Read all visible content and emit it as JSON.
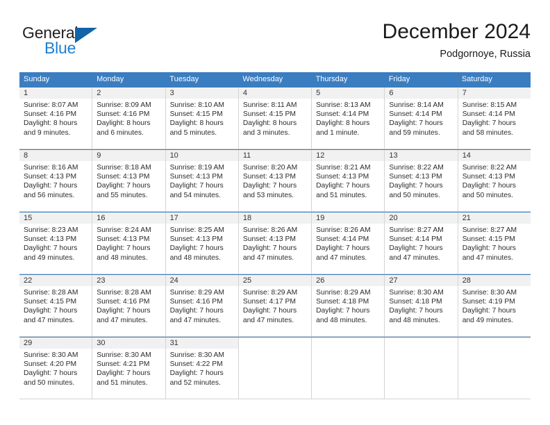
{
  "brand": {
    "name_part1": "General",
    "name_part2": "Blue"
  },
  "header": {
    "title": "December 2024",
    "subtitle": "Podgornoye, Russia"
  },
  "colors": {
    "header_blue": "#3a7dc0",
    "brand_blue": "#1b7fd4",
    "triangle_blue": "#1164a8",
    "daynum_bg": "#f1f1f1",
    "cell_border": "#d4d4d4"
  },
  "weekdays": [
    "Sunday",
    "Monday",
    "Tuesday",
    "Wednesday",
    "Thursday",
    "Friday",
    "Saturday"
  ],
  "weeks": [
    [
      {
        "day": "1",
        "sunrise": "Sunrise: 8:07 AM",
        "sunset": "Sunset: 4:16 PM",
        "daylight1": "Daylight: 8 hours",
        "daylight2": "and 9 minutes."
      },
      {
        "day": "2",
        "sunrise": "Sunrise: 8:09 AM",
        "sunset": "Sunset: 4:16 PM",
        "daylight1": "Daylight: 8 hours",
        "daylight2": "and 6 minutes."
      },
      {
        "day": "3",
        "sunrise": "Sunrise: 8:10 AM",
        "sunset": "Sunset: 4:15 PM",
        "daylight1": "Daylight: 8 hours",
        "daylight2": "and 5 minutes."
      },
      {
        "day": "4",
        "sunrise": "Sunrise: 8:11 AM",
        "sunset": "Sunset: 4:15 PM",
        "daylight1": "Daylight: 8 hours",
        "daylight2": "and 3 minutes."
      },
      {
        "day": "5",
        "sunrise": "Sunrise: 8:13 AM",
        "sunset": "Sunset: 4:14 PM",
        "daylight1": "Daylight: 8 hours",
        "daylight2": "and 1 minute."
      },
      {
        "day": "6",
        "sunrise": "Sunrise: 8:14 AM",
        "sunset": "Sunset: 4:14 PM",
        "daylight1": "Daylight: 7 hours",
        "daylight2": "and 59 minutes."
      },
      {
        "day": "7",
        "sunrise": "Sunrise: 8:15 AM",
        "sunset": "Sunset: 4:14 PM",
        "daylight1": "Daylight: 7 hours",
        "daylight2": "and 58 minutes."
      }
    ],
    [
      {
        "day": "8",
        "sunrise": "Sunrise: 8:16 AM",
        "sunset": "Sunset: 4:13 PM",
        "daylight1": "Daylight: 7 hours",
        "daylight2": "and 56 minutes."
      },
      {
        "day": "9",
        "sunrise": "Sunrise: 8:18 AM",
        "sunset": "Sunset: 4:13 PM",
        "daylight1": "Daylight: 7 hours",
        "daylight2": "and 55 minutes."
      },
      {
        "day": "10",
        "sunrise": "Sunrise: 8:19 AM",
        "sunset": "Sunset: 4:13 PM",
        "daylight1": "Daylight: 7 hours",
        "daylight2": "and 54 minutes."
      },
      {
        "day": "11",
        "sunrise": "Sunrise: 8:20 AM",
        "sunset": "Sunset: 4:13 PM",
        "daylight1": "Daylight: 7 hours",
        "daylight2": "and 53 minutes."
      },
      {
        "day": "12",
        "sunrise": "Sunrise: 8:21 AM",
        "sunset": "Sunset: 4:13 PM",
        "daylight1": "Daylight: 7 hours",
        "daylight2": "and 51 minutes."
      },
      {
        "day": "13",
        "sunrise": "Sunrise: 8:22 AM",
        "sunset": "Sunset: 4:13 PM",
        "daylight1": "Daylight: 7 hours",
        "daylight2": "and 50 minutes."
      },
      {
        "day": "14",
        "sunrise": "Sunrise: 8:22 AM",
        "sunset": "Sunset: 4:13 PM",
        "daylight1": "Daylight: 7 hours",
        "daylight2": "and 50 minutes."
      }
    ],
    [
      {
        "day": "15",
        "sunrise": "Sunrise: 8:23 AM",
        "sunset": "Sunset: 4:13 PM",
        "daylight1": "Daylight: 7 hours",
        "daylight2": "and 49 minutes."
      },
      {
        "day": "16",
        "sunrise": "Sunrise: 8:24 AM",
        "sunset": "Sunset: 4:13 PM",
        "daylight1": "Daylight: 7 hours",
        "daylight2": "and 48 minutes."
      },
      {
        "day": "17",
        "sunrise": "Sunrise: 8:25 AM",
        "sunset": "Sunset: 4:13 PM",
        "daylight1": "Daylight: 7 hours",
        "daylight2": "and 48 minutes."
      },
      {
        "day": "18",
        "sunrise": "Sunrise: 8:26 AM",
        "sunset": "Sunset: 4:13 PM",
        "daylight1": "Daylight: 7 hours",
        "daylight2": "and 47 minutes."
      },
      {
        "day": "19",
        "sunrise": "Sunrise: 8:26 AM",
        "sunset": "Sunset: 4:14 PM",
        "daylight1": "Daylight: 7 hours",
        "daylight2": "and 47 minutes."
      },
      {
        "day": "20",
        "sunrise": "Sunrise: 8:27 AM",
        "sunset": "Sunset: 4:14 PM",
        "daylight1": "Daylight: 7 hours",
        "daylight2": "and 47 minutes."
      },
      {
        "day": "21",
        "sunrise": "Sunrise: 8:27 AM",
        "sunset": "Sunset: 4:15 PM",
        "daylight1": "Daylight: 7 hours",
        "daylight2": "and 47 minutes."
      }
    ],
    [
      {
        "day": "22",
        "sunrise": "Sunrise: 8:28 AM",
        "sunset": "Sunset: 4:15 PM",
        "daylight1": "Daylight: 7 hours",
        "daylight2": "and 47 minutes."
      },
      {
        "day": "23",
        "sunrise": "Sunrise: 8:28 AM",
        "sunset": "Sunset: 4:16 PM",
        "daylight1": "Daylight: 7 hours",
        "daylight2": "and 47 minutes."
      },
      {
        "day": "24",
        "sunrise": "Sunrise: 8:29 AM",
        "sunset": "Sunset: 4:16 PM",
        "daylight1": "Daylight: 7 hours",
        "daylight2": "and 47 minutes."
      },
      {
        "day": "25",
        "sunrise": "Sunrise: 8:29 AM",
        "sunset": "Sunset: 4:17 PM",
        "daylight1": "Daylight: 7 hours",
        "daylight2": "and 47 minutes."
      },
      {
        "day": "26",
        "sunrise": "Sunrise: 8:29 AM",
        "sunset": "Sunset: 4:18 PM",
        "daylight1": "Daylight: 7 hours",
        "daylight2": "and 48 minutes."
      },
      {
        "day": "27",
        "sunrise": "Sunrise: 8:30 AM",
        "sunset": "Sunset: 4:18 PM",
        "daylight1": "Daylight: 7 hours",
        "daylight2": "and 48 minutes."
      },
      {
        "day": "28",
        "sunrise": "Sunrise: 8:30 AM",
        "sunset": "Sunset: 4:19 PM",
        "daylight1": "Daylight: 7 hours",
        "daylight2": "and 49 minutes."
      }
    ],
    [
      {
        "day": "29",
        "sunrise": "Sunrise: 8:30 AM",
        "sunset": "Sunset: 4:20 PM",
        "daylight1": "Daylight: 7 hours",
        "daylight2": "and 50 minutes."
      },
      {
        "day": "30",
        "sunrise": "Sunrise: 8:30 AM",
        "sunset": "Sunset: 4:21 PM",
        "daylight1": "Daylight: 7 hours",
        "daylight2": "and 51 minutes."
      },
      {
        "day": "31",
        "sunrise": "Sunrise: 8:30 AM",
        "sunset": "Sunset: 4:22 PM",
        "daylight1": "Daylight: 7 hours",
        "daylight2": "and 52 minutes."
      },
      {
        "day": "",
        "sunrise": "",
        "sunset": "",
        "daylight1": "",
        "daylight2": ""
      },
      {
        "day": "",
        "sunrise": "",
        "sunset": "",
        "daylight1": "",
        "daylight2": ""
      },
      {
        "day": "",
        "sunrise": "",
        "sunset": "",
        "daylight1": "",
        "daylight2": ""
      },
      {
        "day": "",
        "sunrise": "",
        "sunset": "",
        "daylight1": "",
        "daylight2": ""
      }
    ]
  ]
}
